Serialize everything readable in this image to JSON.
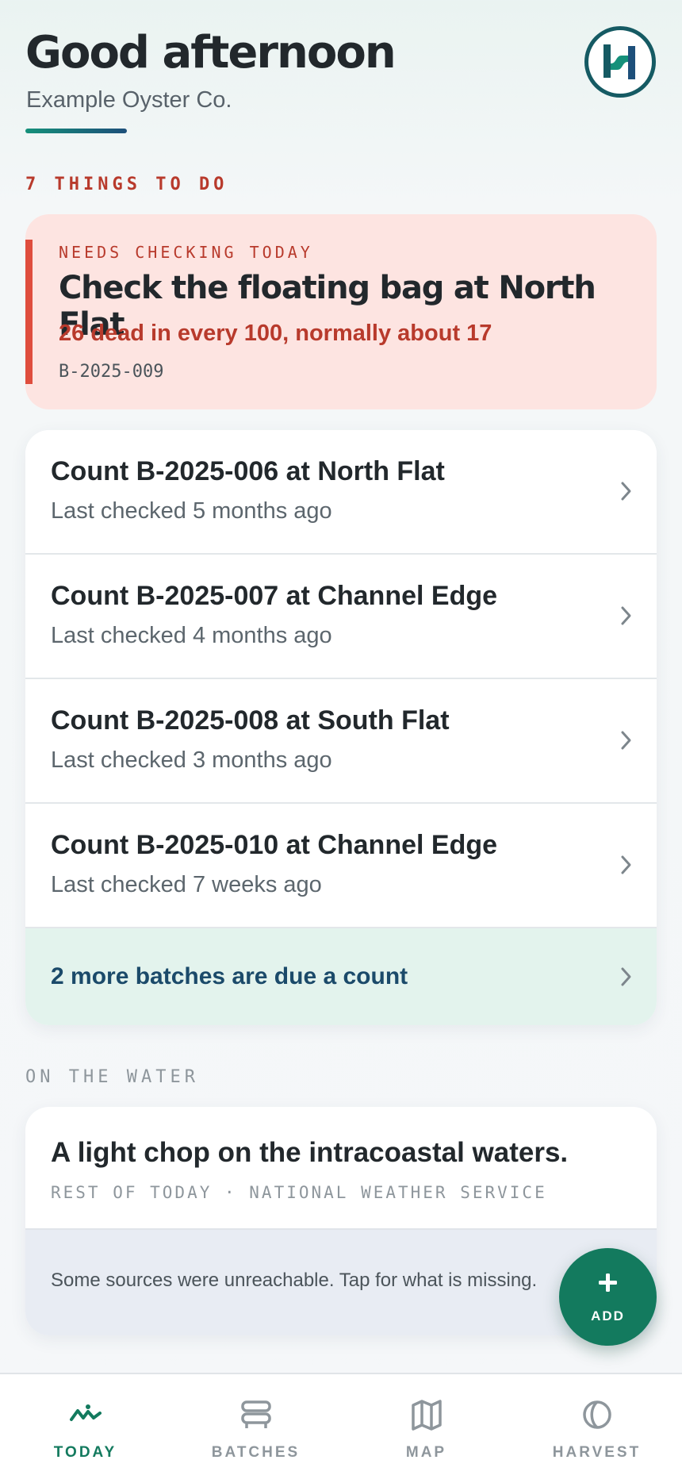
{
  "header": {
    "greeting": "Good afternoon",
    "company": "Example Oyster Co.",
    "logo_icon": "company-logo"
  },
  "todo": {
    "section_label": "7 THINGS TO DO",
    "alert": {
      "kicker": "NEEDS CHECKING TODAY",
      "title": "Check the floating bag at North Flat",
      "detail": "26 dead in every 100, normally about 17",
      "code": "B-2025-009"
    },
    "tasks": [
      {
        "title": "Count B-2025-006 at North Flat",
        "subtitle": "Last checked 5 months ago"
      },
      {
        "title": "Count B-2025-007 at Channel Edge",
        "subtitle": "Last checked 4 months ago"
      },
      {
        "title": "Count B-2025-008 at South Flat",
        "subtitle": "Last checked 3 months ago"
      },
      {
        "title": "Count B-2025-010 at Channel Edge",
        "subtitle": "Last checked 7 weeks ago"
      }
    ],
    "more": "2 more batches are due a count"
  },
  "water": {
    "section_label": "ON THE WATER",
    "title": "A light chop on the intracoastal waters.",
    "source": "REST OF TODAY · NATIONAL WEATHER SERVICE",
    "note": "Some sources were unreachable. Tap for what is missing."
  },
  "fab": {
    "label": "ADD"
  },
  "nav": {
    "items": [
      {
        "label": "TODAY",
        "icon": "wave-icon",
        "active": true
      },
      {
        "label": "BATCHES",
        "icon": "stack-icon",
        "active": false
      },
      {
        "label": "MAP",
        "icon": "map-icon",
        "active": false
      },
      {
        "label": "HARVEST",
        "icon": "moon-icon",
        "active": false
      }
    ]
  },
  "colors": {
    "primary": "#137a5e",
    "alert": "#b83a2c",
    "alert_bg": "#fde4e1",
    "navy": "#1b4a6a"
  }
}
